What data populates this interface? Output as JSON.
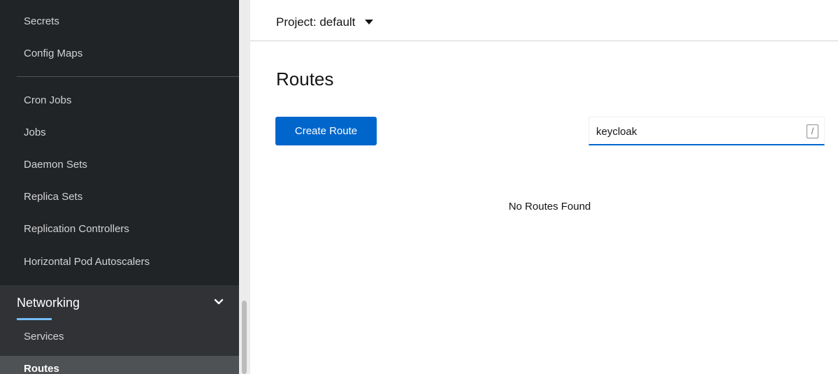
{
  "sidebar": {
    "items_top": [
      {
        "label": "Secrets"
      },
      {
        "label": "Config Maps"
      }
    ],
    "items_workloads": [
      {
        "label": "Cron Jobs"
      },
      {
        "label": "Jobs"
      },
      {
        "label": "Daemon Sets"
      },
      {
        "label": "Replica Sets"
      },
      {
        "label": "Replication Controllers"
      },
      {
        "label": "Horizontal Pod Autoscalers"
      }
    ],
    "networking": {
      "label": "Networking",
      "expanded": true,
      "chevron_icon": "chevron-down-icon",
      "items": [
        {
          "label": "Services",
          "active": false
        },
        {
          "label": "Routes",
          "active": true
        }
      ]
    },
    "colors": {
      "background": "#212427",
      "group_background": "#303236",
      "active_item": "#4f5255",
      "accent": "#73bcf7"
    }
  },
  "header": {
    "project_label": "Project: default",
    "dropdown_icon": "caret-down-icon"
  },
  "main": {
    "title": "Routes",
    "create_button_label": "Create Route",
    "filter": {
      "value": "keycloak",
      "shortcut_hint": "/"
    },
    "empty_message": "No Routes Found",
    "colors": {
      "primary_button": "#0066cc"
    }
  }
}
